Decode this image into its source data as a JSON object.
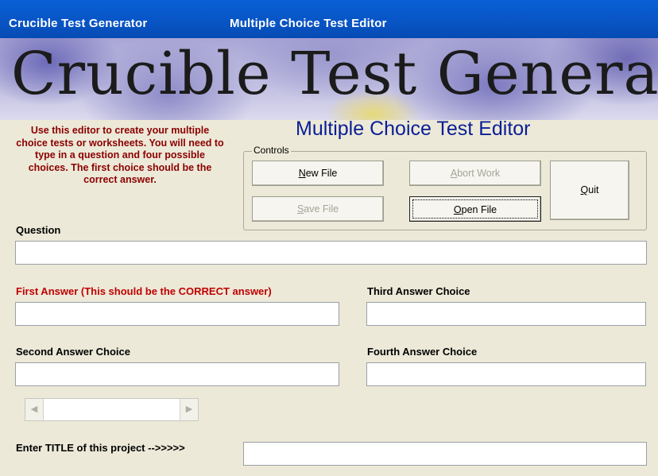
{
  "titlebar": {
    "app_title": "Crucible Test Generator",
    "window_title": "Multiple Choice Test Editor"
  },
  "banner": {
    "logo_text": "Crucible Test Generator"
  },
  "instructions": "Use this editor to create your multiple choice tests or worksheets.  You will need to type in a question and four possible choices.  The first choice should be the correct answer.",
  "subtitle": "Multiple Choice Test Editor",
  "controls": {
    "legend": "Controls",
    "new_file": {
      "mnemonic": "N",
      "rest": "ew File",
      "enabled": true
    },
    "abort_work": {
      "mnemonic": "A",
      "rest": "bort Work",
      "enabled": false
    },
    "quit": {
      "mnemonic": "Q",
      "rest": "uit",
      "enabled": true
    },
    "save_file": {
      "mnemonic": "S",
      "rest": "ave File",
      "enabled": false
    },
    "open_file": {
      "mnemonic": "O",
      "rest": "pen File",
      "enabled": true,
      "focused": true
    }
  },
  "form": {
    "question_label": "Question",
    "question_value": "",
    "first_answer_label": "First Answer (This should be the CORRECT answer)",
    "first_answer_value": "",
    "second_answer_label": "Second Answer Choice",
    "second_answer_value": "",
    "third_answer_label": "Third Answer Choice",
    "third_answer_value": "",
    "fourth_answer_label": "Fourth Answer Choice",
    "fourth_answer_value": "",
    "title_label": "Enter TITLE of this project -->>>>>",
    "title_value": ""
  },
  "scrollbar": {
    "left_icon": "arrow-left-icon",
    "right_icon": "arrow-right-icon"
  },
  "colors": {
    "titlebar": "#0854C4",
    "instructions": "#8B0000",
    "first_answer_label": "#C00000",
    "subtitle": "#0A1E96",
    "background": "#ECE9D8"
  }
}
